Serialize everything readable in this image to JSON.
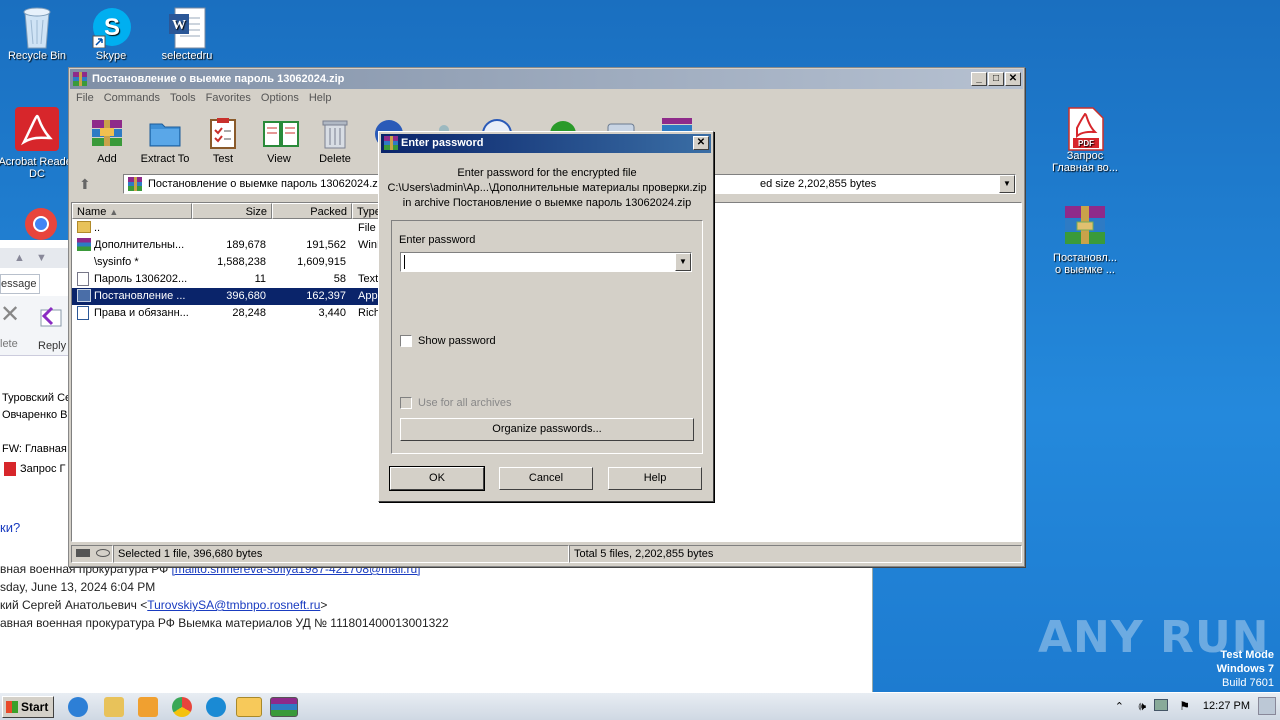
{
  "desktop": {
    "icons_left": [
      {
        "label": "Recycle Bin",
        "name": "recycle-bin"
      },
      {
        "label": "Skype",
        "name": "skype"
      },
      {
        "label": "selectedru",
        "name": "word-doc"
      },
      {
        "label": "Acrobat Reader DC",
        "name": "acrobat-reader"
      }
    ],
    "icons_right": [
      {
        "label": "Запрос Главная во...",
        "name": "pdf-file"
      },
      {
        "label": "Постановл... о выемке ...",
        "name": "rar-archive"
      }
    ],
    "watermark": "ANY RUN",
    "test_mode": [
      "Test Mode",
      "Windows 7",
      "Build 7601"
    ]
  },
  "outlook": {
    "tab": "essage",
    "ribbon_btns": [
      "lete",
      "Reply"
    ],
    "list": [
      "Туровский Се",
      "Овчаренко В",
      "FW: Главная",
      "Запрос Г"
    ],
    "question": "ки?",
    "header": {
      "line1_prefix": "вная военная прокуратура РФ ",
      "line1_link": "[mailto:shmereva-sofiya1987-421708@mail.ru]",
      "line2": "sday, June 13, 2024 6:04 PM",
      "line3_prefix": "кий Сергей Анатольевич <",
      "line3_link": "TurovskiySA@tmbnpo.rosneft.ru",
      "line3_suffix": ">",
      "line4": "авная военная прокуратура РФ Выемка материалов УД № 111801400013001322"
    }
  },
  "winrar": {
    "title": "Постановление о выемке  пароль 13062024.zip",
    "menu": [
      "File",
      "Commands",
      "Tools",
      "Favorites",
      "Options",
      "Help"
    ],
    "tools": [
      "Add",
      "Extract To",
      "Test",
      "View",
      "Delete"
    ],
    "address": "Постановление о выемке  пароль 13062024.zip",
    "address_tail": "ed size 2,202,855 bytes",
    "columns": [
      "Name",
      "Size",
      "Packed",
      "Type"
    ],
    "rows": [
      {
        "name": "..",
        "size": "",
        "packed": "",
        "type": "File f"
      },
      {
        "name": "Дополнительны...",
        "size": "189,678",
        "packed": "191,562",
        "type": "WinR"
      },
      {
        "name": "\\sysinfo *",
        "size": "1,588,238",
        "packed": "1,609,915",
        "type": ""
      },
      {
        "name": "Пароль 1306202...",
        "size": "11",
        "packed": "58",
        "type": "Text"
      },
      {
        "name": "Постановление ...",
        "size": "396,680",
        "packed": "162,397",
        "type": "Appl"
      },
      {
        "name": "Права и обязанн...",
        "size": "28,248",
        "packed": "3,440",
        "type": "Rich"
      }
    ],
    "selected_row": 4,
    "status_left": "Selected 1 file, 396,680 bytes",
    "status_right": "Total 5 files, 2,202,855 bytes"
  },
  "password_dialog": {
    "title": "Enter password",
    "msg1": "Enter password for the encrypted file",
    "msg2": "C:\\Users\\admin\\Ap...\\Дополнительные материалы проверки.zip",
    "msg3": "in archive Постановление о выемке  пароль 13062024.zip",
    "field_label": "Enter password",
    "field_value": "",
    "show_password": "Show password",
    "use_for_all": "Use for all archives",
    "organize": "Organize passwords...",
    "ok": "OK",
    "cancel": "Cancel",
    "help": "Help"
  },
  "taskbar": {
    "start": "Start",
    "clock": "12:27 PM"
  }
}
